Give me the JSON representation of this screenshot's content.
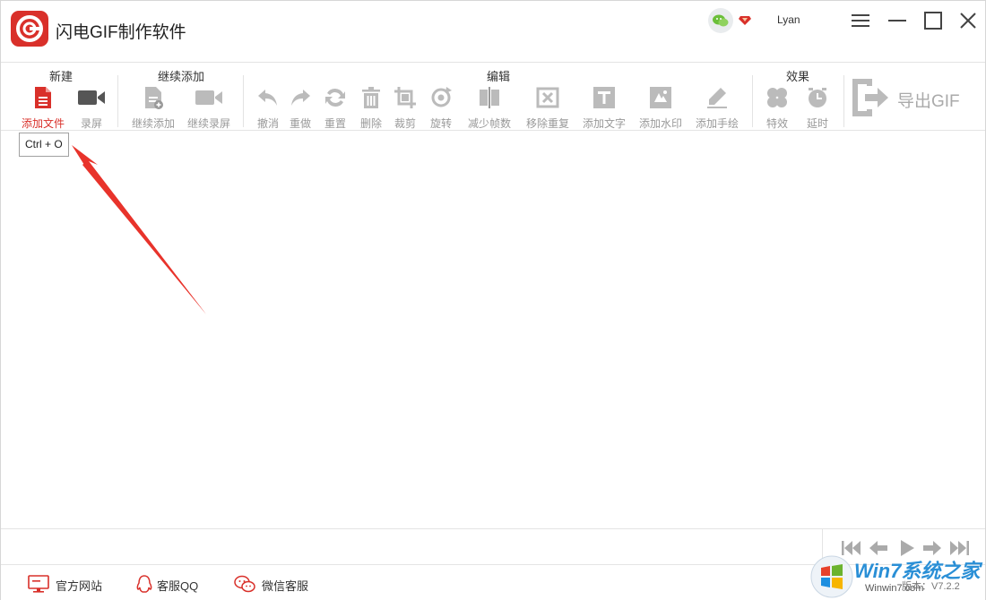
{
  "app": {
    "title": "闪电GIF制作软件",
    "username": "Lyan",
    "accent_color": "#d9302a"
  },
  "window_controls": {
    "menu_icon": "hamburger-icon",
    "minimize_icon": "minimize-icon",
    "maximize_icon": "maximize-icon",
    "close_icon": "close-icon"
  },
  "toolbar": {
    "groups": {
      "new": "新建",
      "continue_add": "继续添加",
      "edit": "编辑",
      "effects": "效果"
    },
    "tools": {
      "add_file": "添加文件",
      "record": "录屏",
      "continue_add": "继续添加",
      "continue_record": "继续录屏",
      "undo": "撤消",
      "redo": "重做",
      "reset": "重置",
      "delete": "删除",
      "crop": "裁剪",
      "rotate": "旋转",
      "reduce_frames": "减少帧数",
      "remove_duplicates": "移除重复",
      "add_text": "添加文字",
      "add_watermark": "添加水印",
      "add_drawing": "添加手绘",
      "effects": "特效",
      "delay": "延时"
    },
    "export": "导出GIF"
  },
  "tooltip": {
    "text": "Ctrl + O"
  },
  "status": {
    "official_site": "官方网站",
    "qq_support": "客服QQ",
    "wechat_support": "微信客服"
  },
  "watermark": {
    "brand": "Win7系统之家",
    "url": "Winwin7.com"
  },
  "version_hint": "版本：V7.2.2"
}
